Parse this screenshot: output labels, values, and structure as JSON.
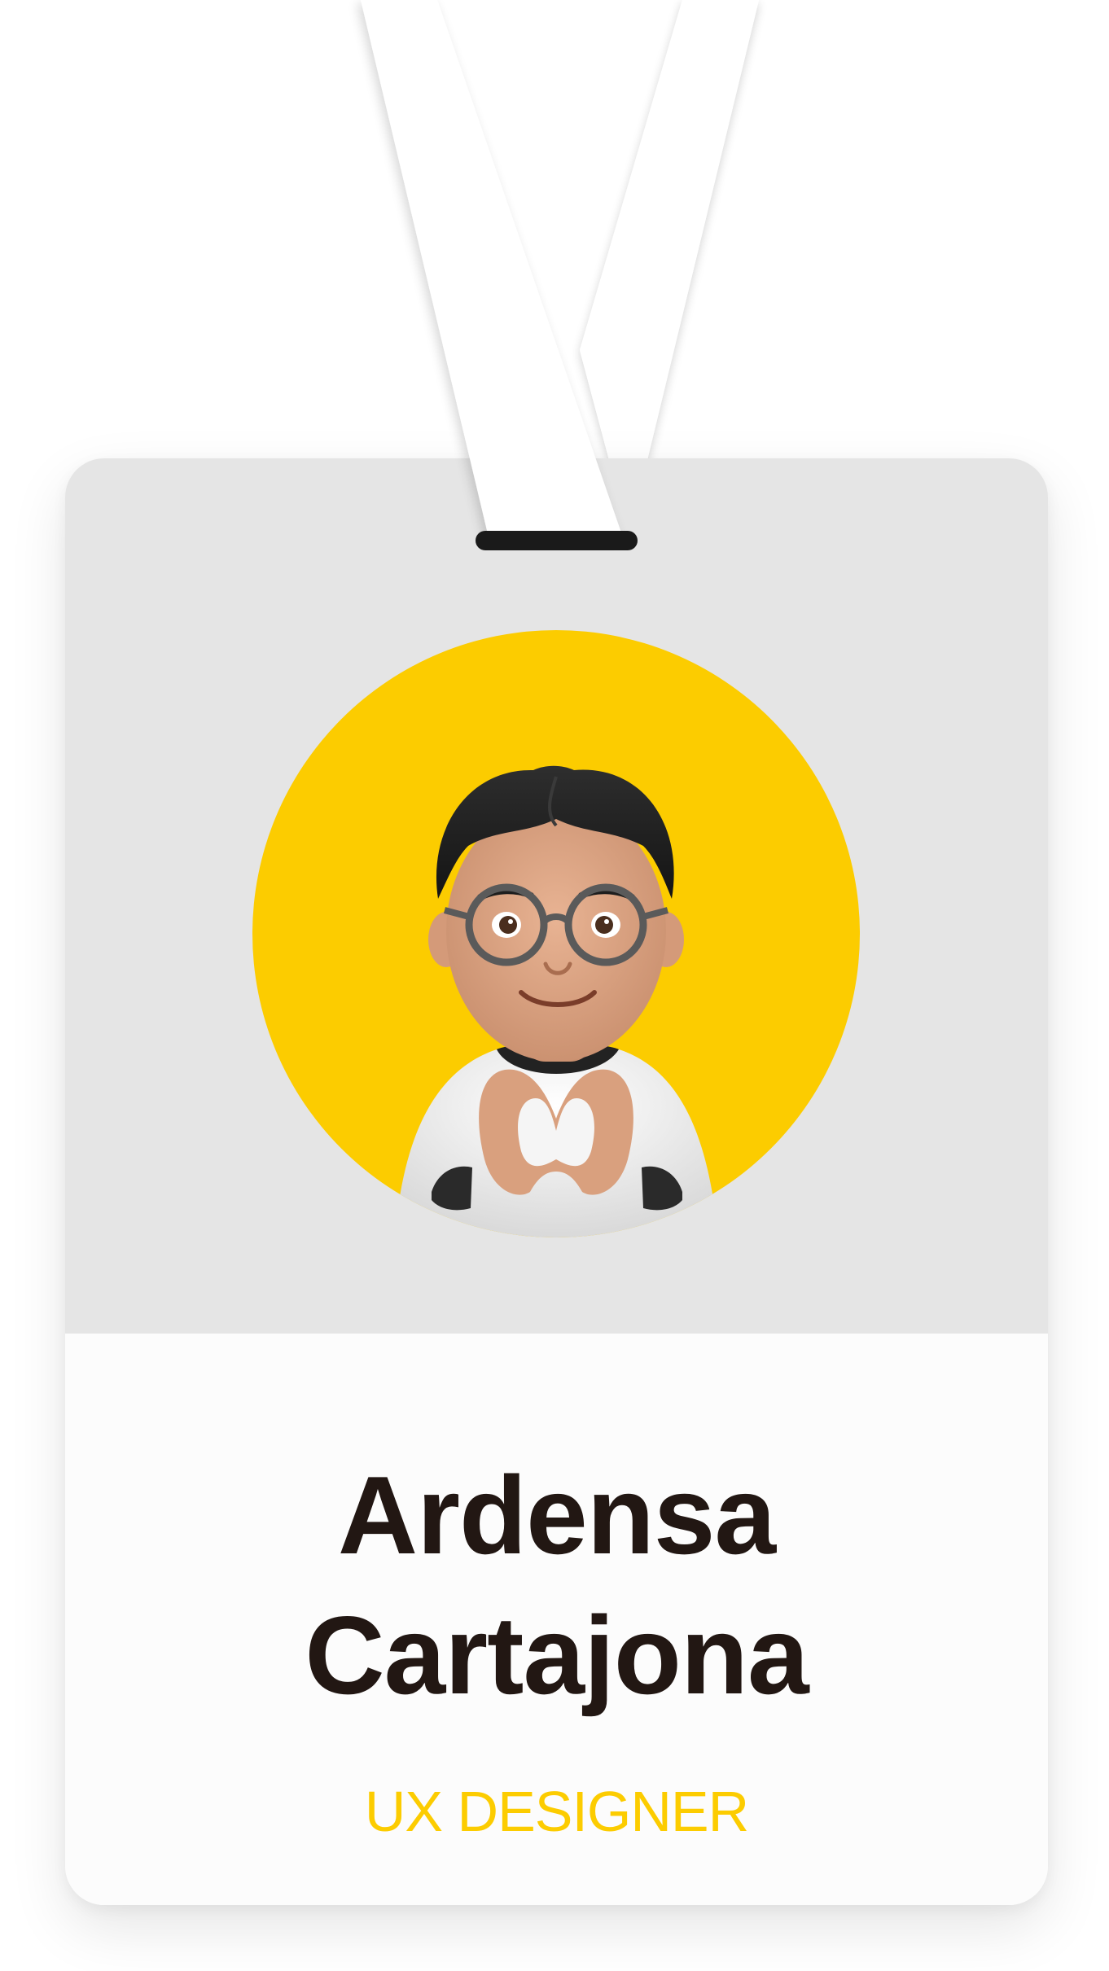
{
  "badge": {
    "first_name": "Ardensa",
    "last_name": "Cartajona",
    "role": "UX DESIGNER"
  },
  "avatar": {
    "icon": "memoji-heart-hands-avatar"
  },
  "colors": {
    "accent": "#fccc00",
    "photo_background": "#e5e5e5",
    "card_background": "#fcfcfc",
    "name_text": "#221713",
    "clip": "#1a1a1a"
  }
}
